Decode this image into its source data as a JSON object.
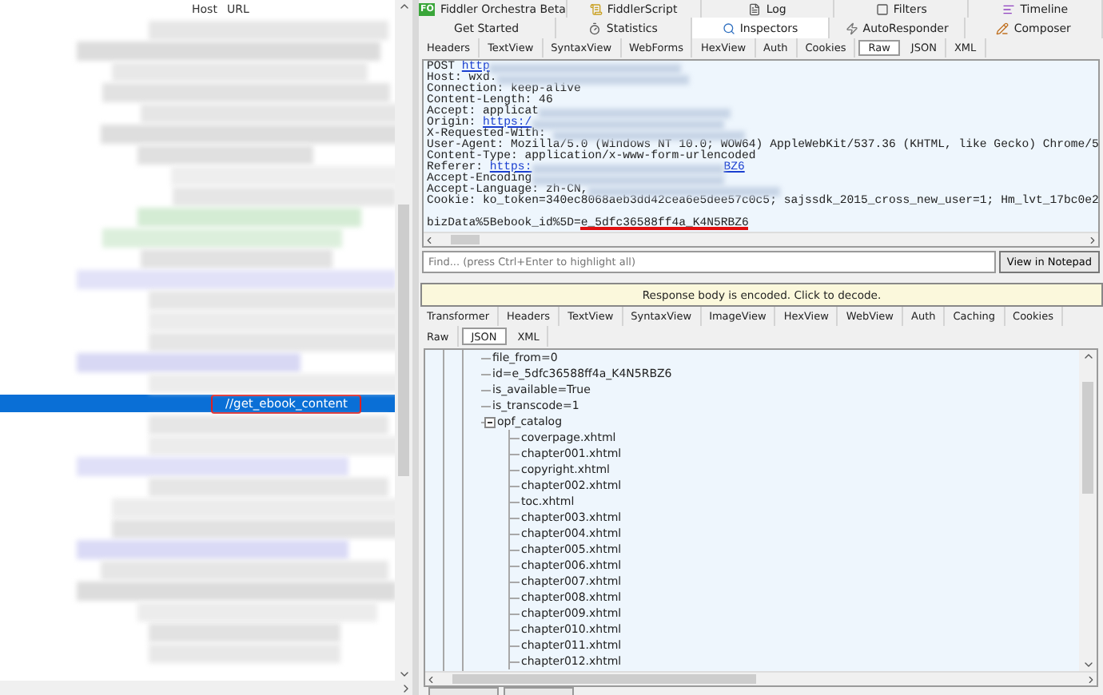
{
  "sessions": {
    "columns": [
      "Host",
      "URL"
    ],
    "rows": [
      {
        "url": "//get_ebook_content",
        "selected": true
      }
    ]
  },
  "top_tabs": [
    {
      "label": "Fiddler Orchestra Beta",
      "badge": "FO",
      "kind": "fo"
    },
    {
      "label": "FiddlerScript",
      "kind": "script"
    },
    {
      "label": "Log",
      "kind": "log"
    },
    {
      "label": "Filters",
      "kind": "filters"
    },
    {
      "label": "Timeline",
      "kind": "timeline"
    }
  ],
  "main_tabs": [
    {
      "label": "Get Started",
      "kind": "none",
      "selected": false
    },
    {
      "label": "Statistics",
      "kind": "stats",
      "selected": false
    },
    {
      "label": "Inspectors",
      "kind": "inspect",
      "selected": true
    },
    {
      "label": "AutoResponder",
      "kind": "auto",
      "selected": false
    },
    {
      "label": "Composer",
      "kind": "compose",
      "selected": false
    }
  ],
  "request": {
    "tabs": [
      {
        "label": "Headers",
        "selected": false
      },
      {
        "label": "TextView",
        "selected": false
      },
      {
        "label": "SyntaxView",
        "selected": false
      },
      {
        "label": "WebForms",
        "selected": false
      },
      {
        "label": "HexView",
        "selected": false
      },
      {
        "label": "Auth",
        "selected": false
      },
      {
        "label": "Cookies",
        "selected": false
      },
      {
        "label": "Raw",
        "selected": true
      },
      {
        "label": "JSON",
        "selected": false
      },
      {
        "label": "XML",
        "selected": false
      }
    ],
    "raw_lines": [
      [
        {
          "kind": "text",
          "text": "POST "
        },
        {
          "kind": "link",
          "text": "http"
        },
        {
          "kind": "blur"
        }
      ],
      [
        {
          "kind": "text",
          "text": "Host: wxd."
        },
        {
          "kind": "blur"
        }
      ],
      [
        {
          "kind": "text",
          "text": "Connection: keep-alive"
        }
      ],
      [
        {
          "kind": "text",
          "text": "Content-Length: 46"
        }
      ],
      [
        {
          "kind": "text",
          "text": "Accept: applicat"
        },
        {
          "kind": "blur"
        }
      ],
      [
        {
          "kind": "text",
          "text": "Origin: "
        },
        {
          "kind": "link",
          "text": "https:/"
        },
        {
          "kind": "blur"
        }
      ],
      [
        {
          "kind": "text",
          "text": "X-Requested-With: "
        },
        {
          "kind": "blur"
        }
      ],
      [
        {
          "kind": "text",
          "text": "User-Agent: Mozilla/5.0 (Windows NT 10.0; WOW64) AppleWebKit/537.36 (KHTML, like Gecko) Chrome/5"
        }
      ],
      [
        {
          "kind": "text",
          "text": "Content-Type: application/x-www-form-urlencoded"
        }
      ],
      [
        {
          "kind": "text",
          "text": "Referer: "
        },
        {
          "kind": "link",
          "text": "https:"
        },
        {
          "kind": "blur"
        },
        {
          "kind": "link",
          "text": "BZ6"
        }
      ],
      [
        {
          "kind": "text",
          "text": "Accept-Encoding"
        },
        {
          "kind": "blur"
        }
      ],
      [
        {
          "kind": "text",
          "text": "Accept-Language: zh-CN,"
        },
        {
          "kind": "blur"
        }
      ],
      [
        {
          "kind": "text",
          "text": "Cookie: ko_token=340ec8068aeb3dd42cea6e5dee57c0c5; sajssdk_2015_cross_new_user=1; Hm_lvt_17bc0e2"
        }
      ],
      [
        {
          "kind": "blank"
        }
      ],
      [
        {
          "kind": "text",
          "text": "bizData%5Bebook_id%5D="
        },
        {
          "kind": "marked",
          "text": "e_5dfc36588ff4a_K4N5RBZ6"
        }
      ]
    ],
    "find": {
      "placeholder": "Find... (press Ctrl+Enter to highlight all)",
      "button": "View in Notepad"
    }
  },
  "response": {
    "banner": "Response body is encoded. Click to decode.",
    "tabs": [
      {
        "label": "Transformer",
        "selected": false
      },
      {
        "label": "Headers",
        "selected": false
      },
      {
        "label": "TextView",
        "selected": false
      },
      {
        "label": "SyntaxView",
        "selected": false
      },
      {
        "label": "ImageView",
        "selected": false
      },
      {
        "label": "HexView",
        "selected": false
      },
      {
        "label": "WebView",
        "selected": false
      },
      {
        "label": "Auth",
        "selected": false
      },
      {
        "label": "Caching",
        "selected": false
      },
      {
        "label": "Cookies",
        "selected": false
      }
    ],
    "tabs_2": [
      {
        "label": "Raw",
        "selected": false
      },
      {
        "label": "JSON",
        "selected": true
      },
      {
        "label": "XML",
        "selected": false
      }
    ],
    "tree": [
      {
        "label": "file_from=0"
      },
      {
        "label": "id=e_5dfc36588ff4a_K4N5RBZ6"
      },
      {
        "label": "is_available=True"
      },
      {
        "label": "is_transcode=1"
      },
      {
        "label": "opf_catalog",
        "expanded": true,
        "children": [
          {
            "label": "coverpage.xhtml"
          },
          {
            "label": "chapter001.xhtml"
          },
          {
            "label": "copyright.xhtml"
          },
          {
            "label": "chapter002.xhtml"
          },
          {
            "label": "toc.xhtml"
          },
          {
            "label": "chapter003.xhtml"
          },
          {
            "label": "chapter004.xhtml"
          },
          {
            "label": "chapter005.xhtml"
          },
          {
            "label": "chapter006.xhtml"
          },
          {
            "label": "chapter007.xhtml"
          },
          {
            "label": "chapter008.xhtml"
          },
          {
            "label": "chapter009.xhtml"
          },
          {
            "label": "chapter010.xhtml"
          },
          {
            "label": "chapter011.xhtml"
          },
          {
            "label": "chapter012.xhtml"
          }
        ]
      }
    ]
  }
}
